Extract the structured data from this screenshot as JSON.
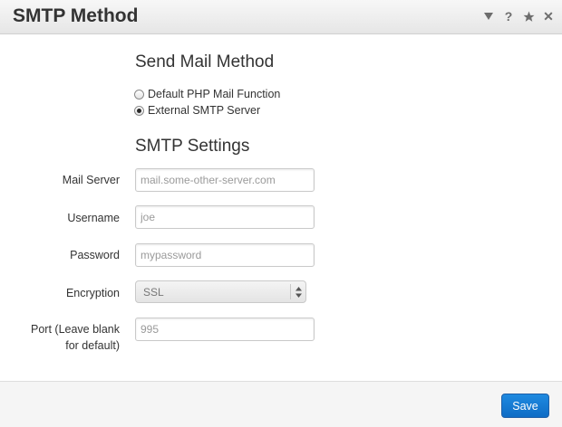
{
  "window": {
    "title": "SMTP Method",
    "icons": [
      "chevron-down-icon",
      "help-icon",
      "star-icon",
      "close-icon"
    ],
    "help_glyph": "?",
    "close_glyph": "✕"
  },
  "send_method": {
    "heading": "Send Mail Method",
    "options": [
      {
        "label": "Default PHP Mail Function",
        "checked": false
      },
      {
        "label": "External SMTP Server",
        "checked": true
      }
    ]
  },
  "smtp": {
    "heading": "SMTP Settings",
    "mail_server": {
      "label": "Mail Server",
      "placeholder": "mail.some-other-server.com"
    },
    "username": {
      "label": "Username",
      "placeholder": "joe"
    },
    "password": {
      "label": "Password",
      "placeholder": "mypassword"
    },
    "encryption": {
      "label": "Encryption",
      "value": "SSL"
    },
    "port": {
      "label": "Port (Leave blank for default)",
      "placeholder": "995"
    }
  },
  "footer": {
    "save_label": "Save"
  },
  "colors": {
    "accent": "#1679d4",
    "title_bar": "#ececec"
  }
}
